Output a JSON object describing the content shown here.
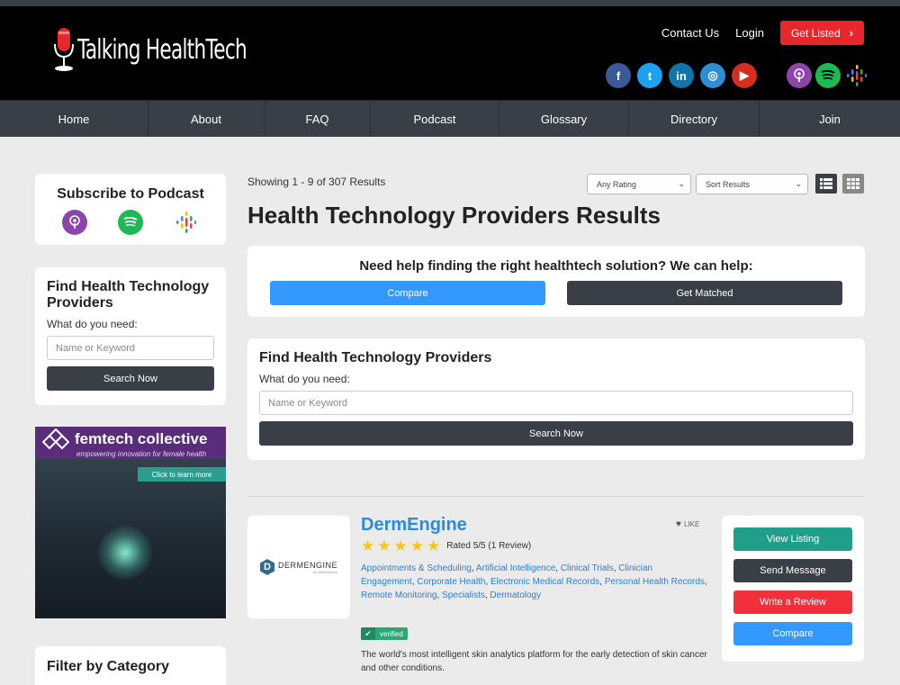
{
  "header": {
    "logo_text": "Talking HealthTech",
    "links": {
      "contact": "Contact Us",
      "login": "Login",
      "get_listed": "Get Listed"
    },
    "social": [
      {
        "icon": "facebook-icon",
        "glyph": "f",
        "color": "#3b5998"
      },
      {
        "icon": "twitter-icon",
        "glyph": "t",
        "color": "#1da1f2"
      },
      {
        "icon": "linkedin-icon",
        "glyph": "in",
        "color": "#0e76a8"
      },
      {
        "icon": "instagram-icon",
        "glyph": "◎",
        "color": "#2c8fd6"
      },
      {
        "icon": "youtube-icon",
        "glyph": "▶",
        "color": "#d62d20"
      }
    ],
    "podcast_icons": [
      "apple-podcasts-icon",
      "spotify-icon",
      "google-podcasts-icon"
    ]
  },
  "nav": {
    "items": [
      "Home",
      "About",
      "FAQ",
      "Podcast",
      "Glossary",
      "Directory",
      "Join"
    ]
  },
  "sidebar": {
    "subscribe_title": "Subscribe to Podcast",
    "find_title": "Find Health Technology Providers",
    "find_label": "What do you need:",
    "find_placeholder": "Name or Keyword",
    "find_button": "Search Now",
    "ad": {
      "brand": "femtech collective",
      "tagline": "empowering innovation for female health",
      "cta": "Click to learn more"
    },
    "filter_title": "Filter by Category"
  },
  "results": {
    "showing": "Showing 1 - 9 of 307 Results",
    "rating_select": "Any Rating",
    "sort_select": "Sort Results",
    "title": "Health Technology Providers Results"
  },
  "help": {
    "title": "Need help finding the right healthtech solution? We can help:",
    "compare": "Compare",
    "get_matched": "Get Matched"
  },
  "main_search": {
    "title": "Find Health Technology Providers",
    "label": "What do you need:",
    "placeholder": "Name or Keyword",
    "button": "Search Now"
  },
  "listing": {
    "logo_text": "DERMENGINE",
    "logo_sub": "by MetaOptima",
    "name": "DermEngine",
    "like": "LIKE",
    "rating_stars": 5,
    "rated": "Rated 5/5 (1 Review)",
    "categories": [
      "Appointments & Scheduling",
      "Artificial Intelligence",
      "Clinical Trials",
      "Clinician Engagement",
      "Corporate Health",
      "Electronic Medical Records",
      "Personal Health Records",
      "Remote Monitoring",
      "Specialists",
      "Dermatology"
    ],
    "verified": "verified",
    "description": "The world's most intelligent skin analytics platform for the early detection of skin cancer and other conditions.",
    "actions": {
      "view": "View Listing",
      "message": "Send Message",
      "review": "Write a Review",
      "compare": "Compare"
    }
  },
  "colors": {
    "header_bg": "#000000",
    "nav_bg": "#3a3f47",
    "accent_red": "#e8262b",
    "accent_blue": "#2a8be0",
    "compare_blue": "#3399ff",
    "teal": "#1f9e8a"
  }
}
